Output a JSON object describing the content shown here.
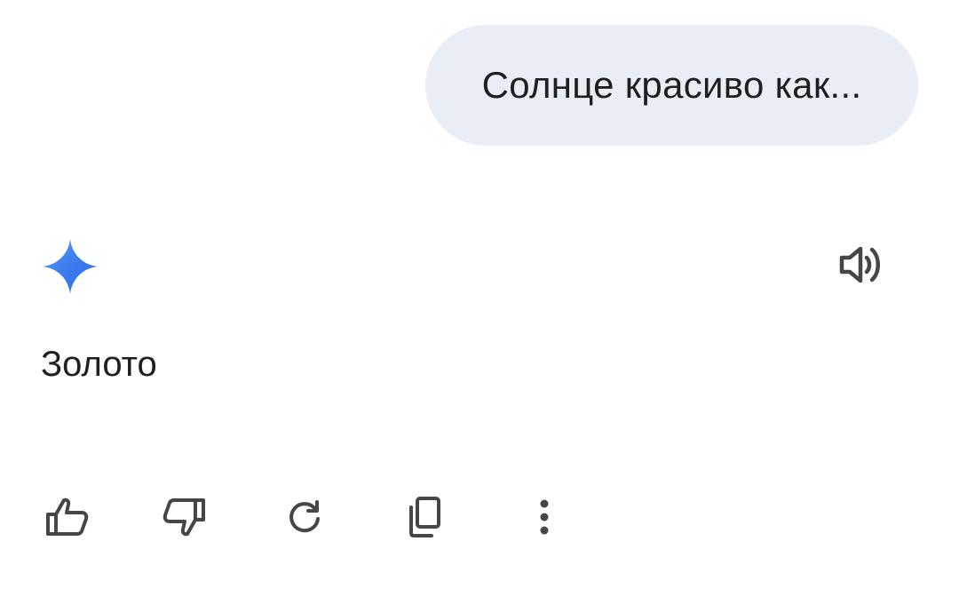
{
  "conversation": {
    "user_message": "Солнце красиво как...",
    "response_text": "Золото"
  },
  "icons": {
    "assistant_logo": "gemini-spark-icon",
    "read_aloud": "speaker-icon",
    "actions": [
      "thumbs-up-icon",
      "thumbs-down-icon",
      "regenerate-icon",
      "copy-icon",
      "more-vert-icon"
    ]
  },
  "colors": {
    "bubble_background": "#e9eef6",
    "text": "#1f1f1f",
    "icon": "#444746",
    "spark_gradient_start": "#4285f4",
    "spark_gradient_end": "#1a73e8"
  }
}
